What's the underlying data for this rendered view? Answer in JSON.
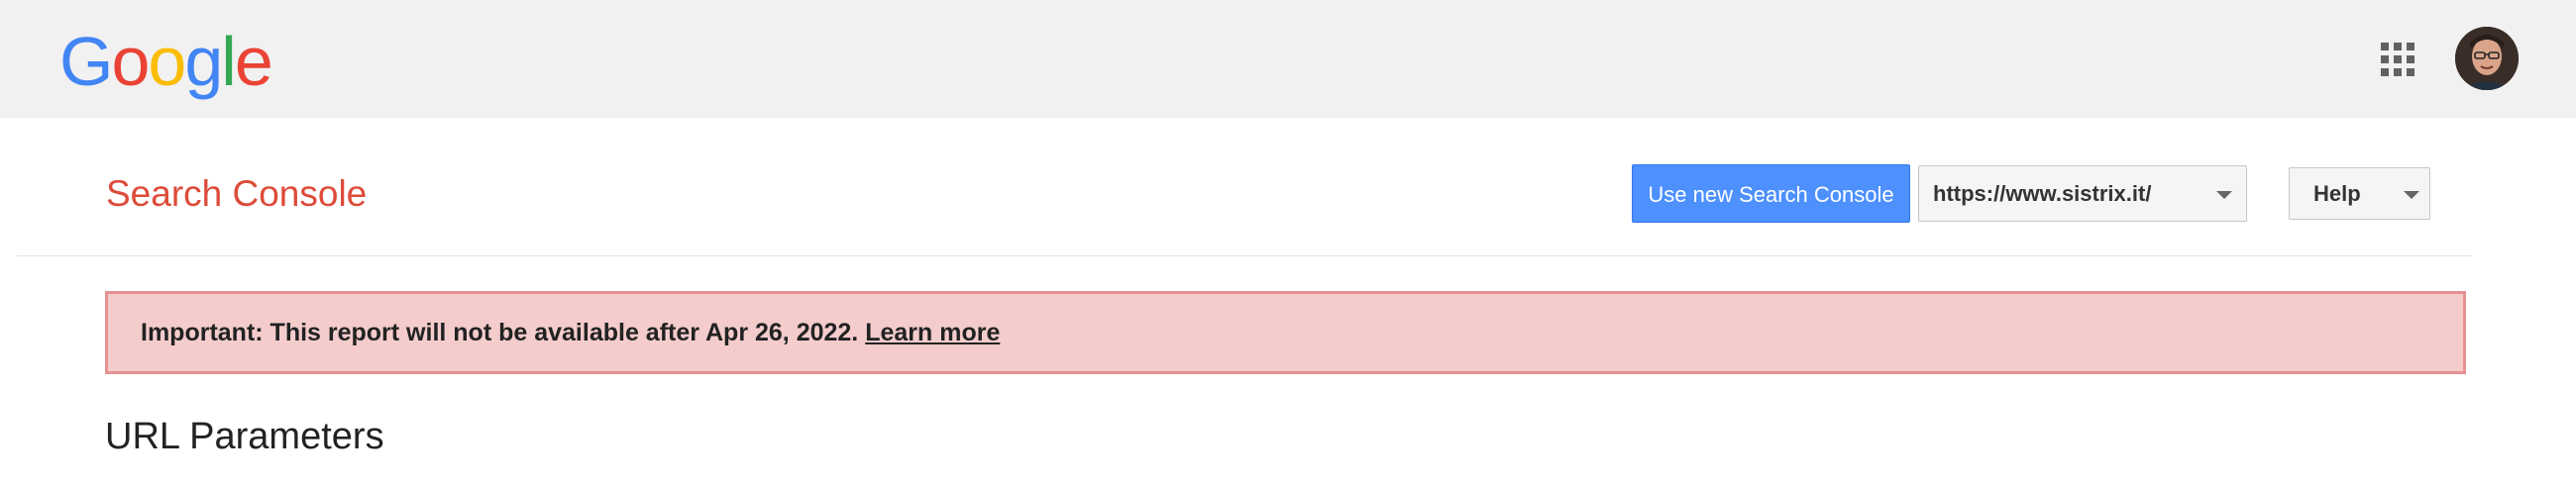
{
  "google_logo": {
    "letters": [
      {
        "char": "G",
        "color": "#4285F4"
      },
      {
        "char": "o",
        "color": "#EA4335"
      },
      {
        "char": "o",
        "color": "#FBBC05"
      },
      {
        "char": "g",
        "color": "#4285F4"
      },
      {
        "char": "l",
        "color": "#34A853"
      },
      {
        "char": "e",
        "color": "#EA4335"
      }
    ]
  },
  "header": {
    "product_title": "Search Console",
    "new_console_button": "Use new Search Console",
    "site_selector_value": "https://www.sistrix.it/",
    "help_label": "Help"
  },
  "banner": {
    "message": "Important: This report will not be available after Apr 26, 2022. ",
    "link_text": "Learn more"
  },
  "page": {
    "heading": "URL Parameters"
  },
  "colors": {
    "accent_blue": "#4d90fe",
    "title_red": "#dd4b39",
    "banner_bg": "#f4cccc",
    "banner_border": "#e69191"
  },
  "icons": {
    "apps": "apps-grid-icon",
    "dropdown": "caret-down-icon"
  }
}
